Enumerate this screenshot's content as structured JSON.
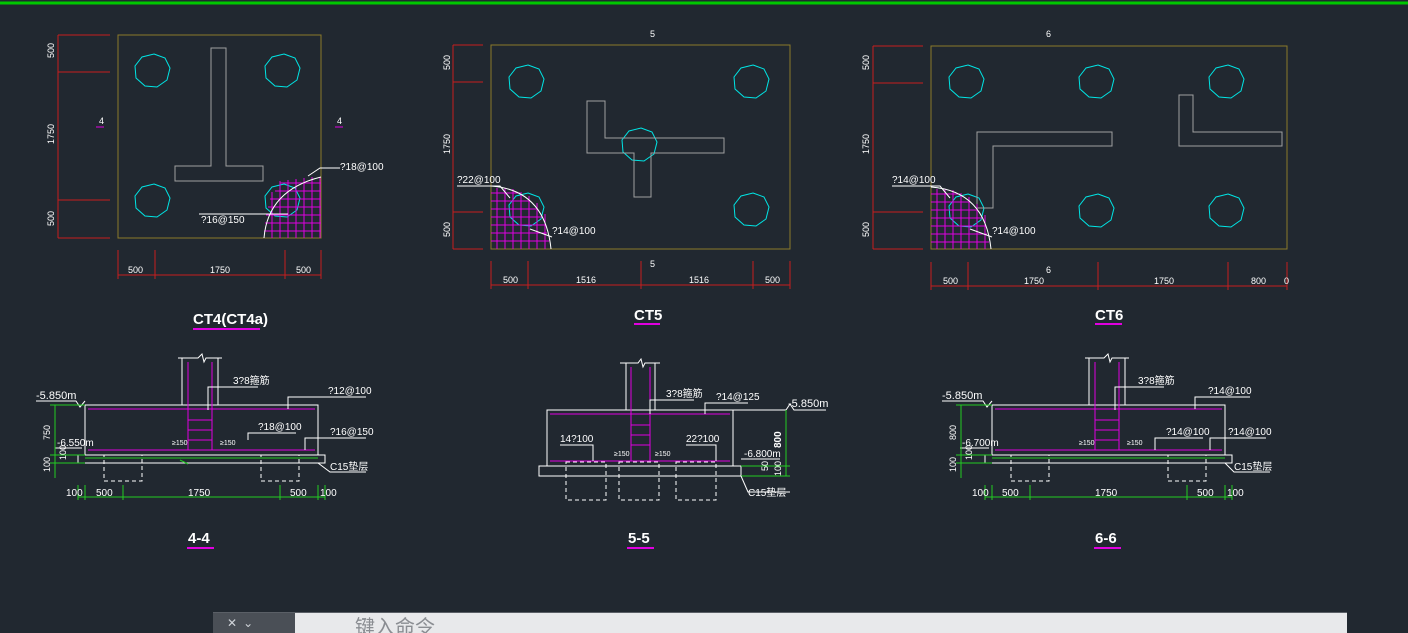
{
  "drawings": {
    "ct4": {
      "title": "CT4(CT4a)",
      "section_mark_left": "4",
      "section_mark_right": "4",
      "dim_left": [
        "500",
        "1750",
        "500"
      ],
      "dim_bottom": [
        "500",
        "1750",
        "500"
      ],
      "rebar_top": "?18@100",
      "rebar_bottom": "?16@150"
    },
    "ct5": {
      "title": "CT5",
      "section_mark_top": "5",
      "section_mark_bottom": "5",
      "dim_left": [
        "500",
        "1750",
        "500"
      ],
      "dim_bottom": [
        "500",
        "1516",
        "1516",
        "500"
      ],
      "rebar_left": "?22@100",
      "rebar_right": "?14@100"
    },
    "ct6": {
      "title": "CT6",
      "section_mark_top": "6",
      "section_mark_bottom": "6",
      "dim_left": [
        "500",
        "1750",
        "500"
      ],
      "dim_bottom": [
        "500",
        "1750",
        "1750",
        "800",
        "0"
      ],
      "rebar_left": "?14@100",
      "rebar_right": "?14@100"
    },
    "s44": {
      "title": "4-4",
      "elev_top": "-5.850m",
      "elev_bottom": "-6.550m",
      "dim_v1": "750",
      "dim_v2": "100",
      "dim_v3": "100",
      "stirrup": "3?8箍筋",
      "rebar1": "?12@100",
      "rebar2": "?18@100",
      "rebar3": "?16@150",
      "c15": "C15垫层",
      "small1": "≥150",
      "small2": "≥150",
      "dims": [
        "100",
        "500",
        "1750",
        "500",
        "100"
      ]
    },
    "s55": {
      "title": "5-5",
      "elev_top": "-5.850m",
      "elev_bottom": "-6.800m",
      "stirrup": "3?8箍筋",
      "rebar_top": "?14@125",
      "rebar_left": "14?100",
      "rebar_right": "22?100",
      "dim_v1": "800",
      "dim_v2": "100",
      "dim_v3": "50",
      "c15": "C15垫层",
      "small1": "≥150",
      "small2": "≥150"
    },
    "s66": {
      "title": "6-6",
      "elev_top": "-5.850m",
      "elev_bottom": "-6.700m",
      "dim_v1": "800",
      "dim_v2": "100",
      "dim_v3": "100",
      "stirrup": "3?8箍筋",
      "rebar1": "?14@100",
      "rebar2": "?14@100",
      "rebar3": "?14@100",
      "c15": "C15垫层",
      "small1": "≥150",
      "small2": "≥150",
      "dims": [
        "100",
        "500",
        "1750",
        "500",
        "100"
      ]
    }
  },
  "command_line": {
    "placeholder": "键入命令",
    "close_glyph": "✕",
    "options_glyph": "⌄"
  },
  "colors": {
    "background": "#212830",
    "top_border": "#00c800",
    "outline": "#8c7a2a",
    "pile": "#00e5e5",
    "dimension": "#c81e1e",
    "rebar": "#e000e0",
    "green": "#22cc22",
    "white": "#ffffff",
    "gray": "#a0a0a0"
  }
}
